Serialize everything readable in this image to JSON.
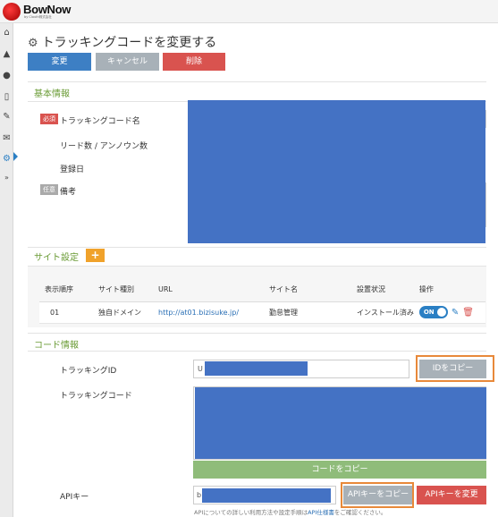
{
  "brand": {
    "name": "BowNow",
    "sub": "by Clouth株式会社"
  },
  "sidebar": {
    "icons": [
      "home-icon",
      "chart-icon",
      "user-icon",
      "mobile-icon",
      "edit-icon",
      "mail-icon",
      "gear-icon",
      "expand-icon"
    ]
  },
  "page": {
    "title": "トラッキングコードを変更する"
  },
  "actions": {
    "change": "変更",
    "cancel": "キャンセル",
    "delete": "削除"
  },
  "basic": {
    "title": "基本情報",
    "required_badge": "必須",
    "optional_badge": "任意",
    "name_label": "トラッキングコード名",
    "leads_label": "リード数 / アンノウン数",
    "registered_label": "登録日",
    "note_label": "備考"
  },
  "site": {
    "title": "サイト設定",
    "add": "+",
    "columns": [
      "表示順序",
      "サイト種別",
      "URL",
      "サイト名",
      "設置状況",
      "操作"
    ],
    "rows": [
      {
        "order": "01",
        "type": "独自ドメイン",
        "url": "http://at01.bizisuke.jp/",
        "name": "勤怠管理",
        "status": "インストール済み",
        "toggle": "ON"
      }
    ]
  },
  "code": {
    "title": "コード情報",
    "id_label": "トラッキングID",
    "id_value_prefix": "U",
    "copy_id": "IDをコピー",
    "code_label": "トラッキングコード",
    "copy_code": "コードをコピー",
    "api_label": "APIキー",
    "api_value_prefix": "b",
    "copy_api": "APIキーをコピー",
    "change_api": "APIキーを変更",
    "footnote_before": "APIについての詳しい利用方法や設定手順は",
    "footnote_link": "API仕様書",
    "footnote_after": "をご確認ください。"
  }
}
